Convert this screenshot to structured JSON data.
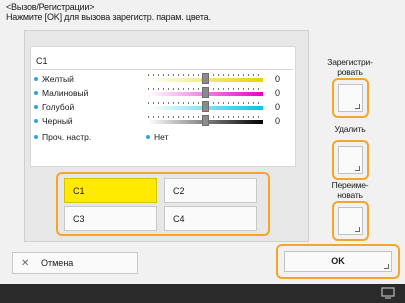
{
  "header": {
    "title": "<Вызов/Регистрации>",
    "instruction": "Нажмите [OK] для вызова зарегистр. парам. цвета."
  },
  "panel": {
    "preset_name": "C1",
    "sliders": [
      {
        "label": "Желтый",
        "value": "0",
        "gradient_color": "#e6d400"
      },
      {
        "label": "Малиновый",
        "value": "0",
        "gradient_color": "#e600c8"
      },
      {
        "label": "Голубой",
        "value": "0",
        "gradient_color": "#00c8e6"
      },
      {
        "label": "Черный",
        "value": "0",
        "gradient_color": "#000000"
      }
    ],
    "other": {
      "label": "Проч. настр.",
      "value": "Нет"
    }
  },
  "presets": [
    "C1",
    "C2",
    "C3",
    "C4"
  ],
  "selected_preset": "C1",
  "side": {
    "register": "Зарегистри-\nровать",
    "delete": "Удалить",
    "rename": "Переиме-\nновать"
  },
  "buttons": {
    "cancel": "Отмена",
    "ok": "OK"
  },
  "colors": {
    "accent": "#f4a52a",
    "selected": "#ffea00",
    "bullet": "#2aa9d6"
  }
}
